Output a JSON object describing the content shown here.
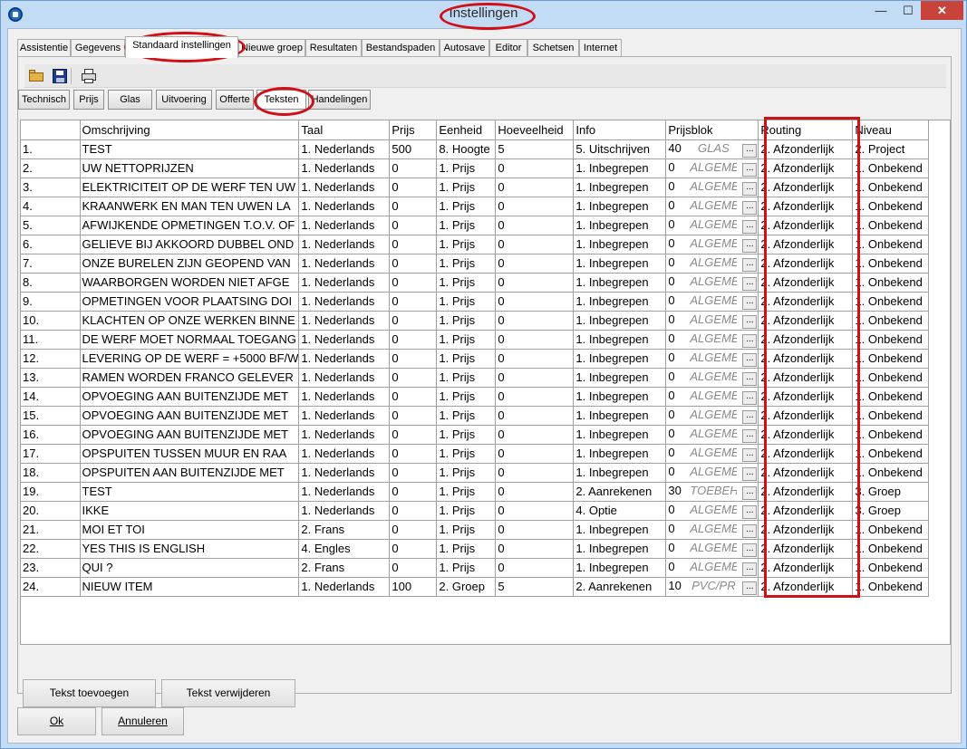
{
  "window": {
    "title": "Instellingen",
    "minimize": "—",
    "maximize": "☐",
    "close": "✕"
  },
  "tabs": [
    {
      "label": "Assistentie"
    },
    {
      "label": "Gegevens"
    },
    {
      "label": "Standaard instellingen"
    },
    {
      "label": "Nieuwe groep"
    },
    {
      "label": "Resultaten"
    },
    {
      "label": "Bestandspaden"
    },
    {
      "label": "Autosave"
    },
    {
      "label": "Editor"
    },
    {
      "label": "Schetsen"
    },
    {
      "label": "Internet"
    }
  ],
  "active_tab": "Standaard instellingen",
  "toolbar": {
    "icons": [
      "open-folder-icon",
      "save-disk-icon",
      "print-icon"
    ]
  },
  "subtabs": [
    {
      "label": "Technisch"
    },
    {
      "label": "Prijs"
    },
    {
      "label": "Glas"
    },
    {
      "label": "Uitvoering"
    },
    {
      "label": "Offerte"
    },
    {
      "label": "Teksten"
    },
    {
      "label": "Handelingen"
    }
  ],
  "active_subtab": "Teksten",
  "table": {
    "columns": [
      "",
      "Omschrijving",
      "Taal",
      "Prijs",
      "Eenheid",
      "Hoeveelheid",
      "Info",
      "Prijsblok",
      "Routing",
      "Niveau"
    ],
    "rows": [
      [
        "1.",
        "TEST",
        "1. Nederlands",
        "500",
        "8. Hoogte",
        "5",
        "5. Uitschrijven",
        "40",
        "GLAS",
        "2. Afzonderlijk",
        "2. Project"
      ],
      [
        "2.",
        "UW NETTOPRIJZEN",
        "1. Nederlands",
        "0",
        "1. Prijs",
        "0",
        "1. Inbegrepen",
        "0",
        "ALGEMEEN",
        "2. Afzonderlijk",
        "1. Onbekend"
      ],
      [
        "3.",
        "ELEKTRICITEIT OP DE WERF TEN UW",
        "1. Nederlands",
        "0",
        "1. Prijs",
        "0",
        "1. Inbegrepen",
        "0",
        "ALGEMEEN",
        "2. Afzonderlijk",
        "1. Onbekend"
      ],
      [
        "4.",
        "KRAANWERK EN MAN TEN UWEN LA",
        "1. Nederlands",
        "0",
        "1. Prijs",
        "0",
        "1. Inbegrepen",
        "0",
        "ALGEMEEN",
        "2. Afzonderlijk",
        "1. Onbekend"
      ],
      [
        "5.",
        "AFWIJKENDE OPMETINGEN T.O.V. OF",
        "1. Nederlands",
        "0",
        "1. Prijs",
        "0",
        "1. Inbegrepen",
        "0",
        "ALGEMEEN",
        "2. Afzonderlijk",
        "1. Onbekend"
      ],
      [
        "6.",
        "GELIEVE BIJ AKKOORD DUBBEL OND",
        "1. Nederlands",
        "0",
        "1. Prijs",
        "0",
        "1. Inbegrepen",
        "0",
        "ALGEMEEN",
        "2. Afzonderlijk",
        "1. Onbekend"
      ],
      [
        "7.",
        "ONZE BURELEN ZIJN GEOPEND VAN",
        "1. Nederlands",
        "0",
        "1. Prijs",
        "0",
        "1. Inbegrepen",
        "0",
        "ALGEMEEN",
        "2. Afzonderlijk",
        "1. Onbekend"
      ],
      [
        "8.",
        "WAARBORGEN WORDEN NIET AFGE",
        "1. Nederlands",
        "0",
        "1. Prijs",
        "0",
        "1. Inbegrepen",
        "0",
        "ALGEMEEN",
        "2. Afzonderlijk",
        "1. Onbekend"
      ],
      [
        "9.",
        "OPMETINGEN VOOR PLAATSING DOI",
        "1. Nederlands",
        "0",
        "1. Prijs",
        "0",
        "1. Inbegrepen",
        "0",
        "ALGEMEEN",
        "2. Afzonderlijk",
        "1. Onbekend"
      ],
      [
        "10.",
        "KLACHTEN OP ONZE WERKEN BINNE",
        "1. Nederlands",
        "0",
        "1. Prijs",
        "0",
        "1. Inbegrepen",
        "0",
        "ALGEMEEN",
        "2. Afzonderlijk",
        "1. Onbekend"
      ],
      [
        "11.",
        "DE WERF MOET NORMAAL TOEGANG",
        "1. Nederlands",
        "0",
        "1. Prijs",
        "0",
        "1. Inbegrepen",
        "0",
        "ALGEMEEN",
        "2. Afzonderlijk",
        "1. Onbekend"
      ],
      [
        "12.",
        "LEVERING OP DE WERF = +5000 BF/W",
        "1. Nederlands",
        "0",
        "1. Prijs",
        "0",
        "1. Inbegrepen",
        "0",
        "ALGEMEEN",
        "2. Afzonderlijk",
        "1. Onbekend"
      ],
      [
        "13.",
        "RAMEN WORDEN FRANCO GELEVER",
        "1. Nederlands",
        "0",
        "1. Prijs",
        "0",
        "1. Inbegrepen",
        "0",
        "ALGEMEEN",
        "2. Afzonderlijk",
        "1. Onbekend"
      ],
      [
        "14.",
        "OPVOEGING AAN BUITENZIJDE MET",
        "1. Nederlands",
        "0",
        "1. Prijs",
        "0",
        "1. Inbegrepen",
        "0",
        "ALGEMEEN",
        "2. Afzonderlijk",
        "1. Onbekend"
      ],
      [
        "15.",
        "OPVOEGING AAN BUITENZIJDE MET",
        "1. Nederlands",
        "0",
        "1. Prijs",
        "0",
        "1. Inbegrepen",
        "0",
        "ALGEMEEN",
        "2. Afzonderlijk",
        "1. Onbekend"
      ],
      [
        "16.",
        "OPVOEGING AAN BUITENZIJDE MET",
        "1. Nederlands",
        "0",
        "1. Prijs",
        "0",
        "1. Inbegrepen",
        "0",
        "ALGEMEEN",
        "2. Afzonderlijk",
        "1. Onbekend"
      ],
      [
        "17.",
        "OPSPUITEN TUSSEN MUUR EN RAA",
        "1. Nederlands",
        "0",
        "1. Prijs",
        "0",
        "1. Inbegrepen",
        "0",
        "ALGEMEEN",
        "2. Afzonderlijk",
        "1. Onbekend"
      ],
      [
        "18.",
        "OPSPUITEN AAN BUITENZIJDE MET",
        "1. Nederlands",
        "0",
        "1. Prijs",
        "0",
        "1. Inbegrepen",
        "0",
        "ALGEMEEN",
        "2. Afzonderlijk",
        "1. Onbekend"
      ],
      [
        "19.",
        "TEST",
        "1. Nederlands",
        "0",
        "1. Prijs",
        "0",
        "2. Aanrekenen",
        "30",
        "TOEBEH",
        "2. Afzonderlijk",
        "3. Groep"
      ],
      [
        "20.",
        "IKKE",
        "1. Nederlands",
        "0",
        "1. Prijs",
        "0",
        "4. Optie",
        "0",
        "ALGEMEEN",
        "2. Afzonderlijk",
        "3. Groep"
      ],
      [
        "21.",
        "MOI ET TOI",
        "2. Frans",
        "0",
        "1. Prijs",
        "0",
        "1. Inbegrepen",
        "0",
        "ALGEMEEN",
        "2. Afzonderlijk",
        "1. Onbekend"
      ],
      [
        "22.",
        "YES THIS IS ENGLISH",
        "4. Engles",
        "0",
        "1. Prijs",
        "0",
        "1. Inbegrepen",
        "0",
        "ALGEMEEN",
        "2. Afzonderlijk",
        "1. Onbekend"
      ],
      [
        "23.",
        "QUI ?",
        "2. Frans",
        "0",
        "1. Prijs",
        "0",
        "1. Inbegrepen",
        "0",
        "ALGEMEEN",
        "2. Afzonderlijk",
        "1. Onbekend"
      ],
      [
        "24.",
        "NIEUW ITEM",
        "1. Nederlands",
        "100",
        "2. Groep",
        "5",
        "2. Aanrekenen",
        "10",
        "PVC/PR",
        "2. Afzonderlijk",
        "1. Onbekend"
      ]
    ],
    "ellipsis": "..."
  },
  "buttons": {
    "add_text": "Tekst toevoegen",
    "remove_text": "Tekst verwijderen",
    "ok": "Ok",
    "cancel": "Annuleren"
  },
  "colors": {
    "highlight_red": "#d10f16",
    "title_bar": "#c3dcf6",
    "close_button": "#c8433a"
  }
}
